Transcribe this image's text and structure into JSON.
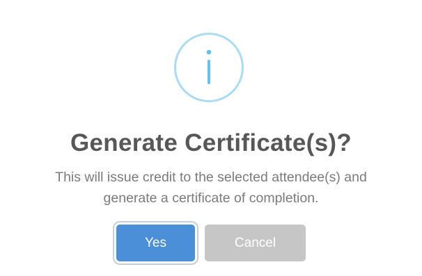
{
  "dialog": {
    "icon": "info-icon",
    "title": "Generate Certificate(s)?",
    "message": "This will issue credit to the selected attendee(s) and generate a certificate of completion.",
    "confirm_label": "Yes",
    "cancel_label": "Cancel"
  },
  "colors": {
    "icon_ring": "#a9dcf3",
    "icon_glyph": "#5ec4ee",
    "confirm_button": "#4a8fd8",
    "cancel_button": "#c6c6c6",
    "title_text": "#575757",
    "message_text": "#7b7b7b"
  }
}
